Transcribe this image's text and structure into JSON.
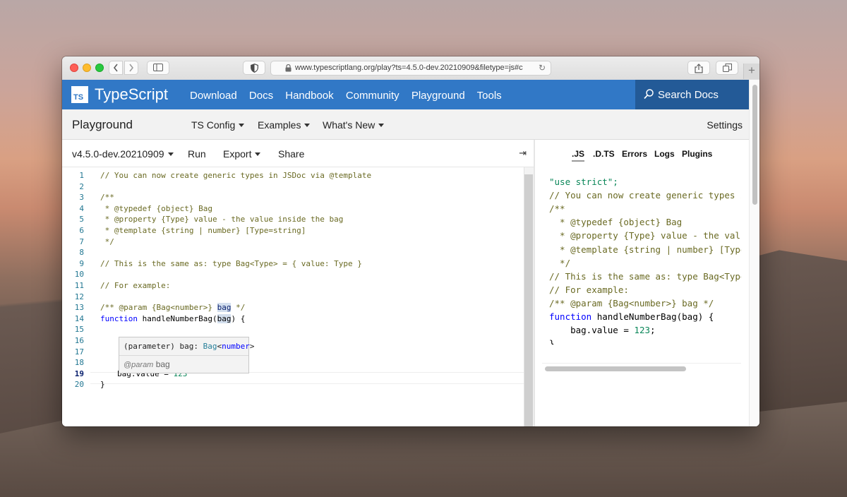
{
  "browser": {
    "url": "www.typescriptlang.org/play?ts=4.5.0-dev.20210909&filetype=js#c"
  },
  "site": {
    "logo_badge": "TS",
    "name": "TypeScript",
    "nav": [
      "Download",
      "Docs",
      "Handbook",
      "Community",
      "Playground",
      "Tools"
    ],
    "search": "Search Docs"
  },
  "playground_bar": {
    "title": "Playground",
    "menus": [
      "TS Config",
      "Examples",
      "What's New"
    ],
    "settings": "Settings"
  },
  "editor_toolbar": {
    "version": "v4.5.0-dev.20210909",
    "run": "Run",
    "export": "Export",
    "share": "Share",
    "collapse_glyph": "⇥"
  },
  "editor_lines": [
    {
      "n": "1",
      "text": "// You can now create generic types in JSDoc via @template"
    },
    {
      "n": "2",
      "text": ""
    },
    {
      "n": "3",
      "text": "/**"
    },
    {
      "n": "4",
      "text": " * @typedef {object} Bag"
    },
    {
      "n": "5",
      "text": " * @property {Type} value - the value inside the bag"
    },
    {
      "n": "6",
      "text": " * @template {string | number} [Type=string]"
    },
    {
      "n": "7",
      "text": " */"
    },
    {
      "n": "8",
      "text": ""
    },
    {
      "n": "9",
      "text": "// This is the same as: type Bag<Type> = { value: Type }"
    },
    {
      "n": "10",
      "text": ""
    },
    {
      "n": "11",
      "text": "// For example:"
    },
    {
      "n": "12",
      "text": ""
    },
    {
      "n": "13",
      "text": "/** @param {Bag<number>} "
    },
    {
      "n": "14",
      "text": ""
    },
    {
      "n": "15",
      "text": ""
    },
    {
      "n": "16",
      "text": ""
    },
    {
      "n": "17",
      "text": ""
    },
    {
      "n": "18",
      "text": ""
    },
    {
      "n": "19",
      "text": ""
    },
    {
      "n": "20",
      "text": "}"
    }
  ],
  "editor_tokens": {
    "l13_bag": "bag",
    "l13_end": " */",
    "l14_kw": "function",
    "l14_fn": " handleNumberBag(",
    "l14_param": "bag",
    "l14_end": ") {",
    "l19_var": "bag",
    "l19_mid": ".value = ",
    "l19_num": "123"
  },
  "tooltip": {
    "sig_prefix": "(parameter) bag: ",
    "sig_type": "Bag",
    "sig_lt": "<",
    "sig_arg": "number",
    "sig_gt": ">",
    "doc_tag": "@param",
    "doc_name": "bag"
  },
  "output_tabs": [
    ".JS",
    ".D.TS",
    "Errors",
    "Logs",
    "Plugins"
  ],
  "output_lines": [
    {
      "cls": "str",
      "text": "\"use strict\";"
    },
    {
      "cls": "cmt2",
      "text": "// You can now create generic types in"
    },
    {
      "cls": "cmt2",
      "text": "/**"
    },
    {
      "cls": "cmt2",
      "text": "  * @typedef {object} Bag"
    },
    {
      "cls": "cmt2",
      "text": "  * @property {Type} value - the value"
    },
    {
      "cls": "cmt2",
      "text": "  * @template {string | number} [Type="
    },
    {
      "cls": "cmt2",
      "text": "  */"
    },
    {
      "cls": "cmt2",
      "text": "// This is the same as: type Bag<Type>"
    },
    {
      "cls": "cmt2",
      "text": "// For example:"
    },
    {
      "cls": "cmt2",
      "text": "/** @param {Bag<number>} bag */"
    },
    {
      "cls": "",
      "text": ""
    },
    {
      "cls": "",
      "text": "    bag.value = 123;"
    },
    {
      "cls": "",
      "text": "}"
    }
  ],
  "output_tokens": {
    "fn_kw": "function",
    "fn_rest": " handleNumberBag(bag) {",
    "num": "123"
  }
}
